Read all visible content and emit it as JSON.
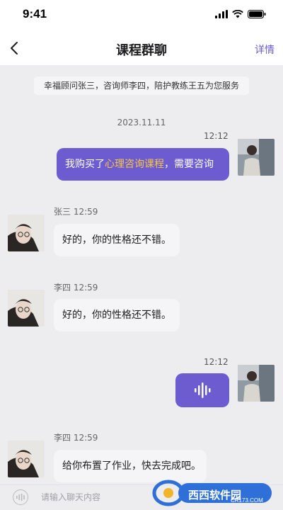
{
  "status_bar": {
    "time": "9:41"
  },
  "header": {
    "title": "课程群聊",
    "detail_label": "详情"
  },
  "notice": "幸福顾问张三，咨询师李四，陪护教练王五为您服务",
  "date": "2023.11.11",
  "messages": [
    {
      "side": "me",
      "time": "12:12",
      "text_before": "我购买了",
      "highlight": "心理咨询课程",
      "text_after": "，需要咨询"
    },
    {
      "side": "other",
      "sender": "张三",
      "time": "12:59",
      "text": "好的，你的性格还不错。"
    },
    {
      "side": "other",
      "sender": "李四",
      "time": "12:59",
      "text": "好的，你的性格还不错。"
    },
    {
      "side": "me",
      "time": "12:12",
      "type": "voice"
    },
    {
      "side": "other",
      "sender": "李四",
      "time": "12:59",
      "text": "给你布置了作业，快去完成吧。"
    }
  ],
  "input": {
    "placeholder": "请输入聊天内容"
  },
  "watermark": {
    "brand": "西西软件园",
    "url": "CR173.COM"
  },
  "colors": {
    "accent": "#6d5bd0",
    "highlight": "#f7c744",
    "background": "#ededf0"
  }
}
